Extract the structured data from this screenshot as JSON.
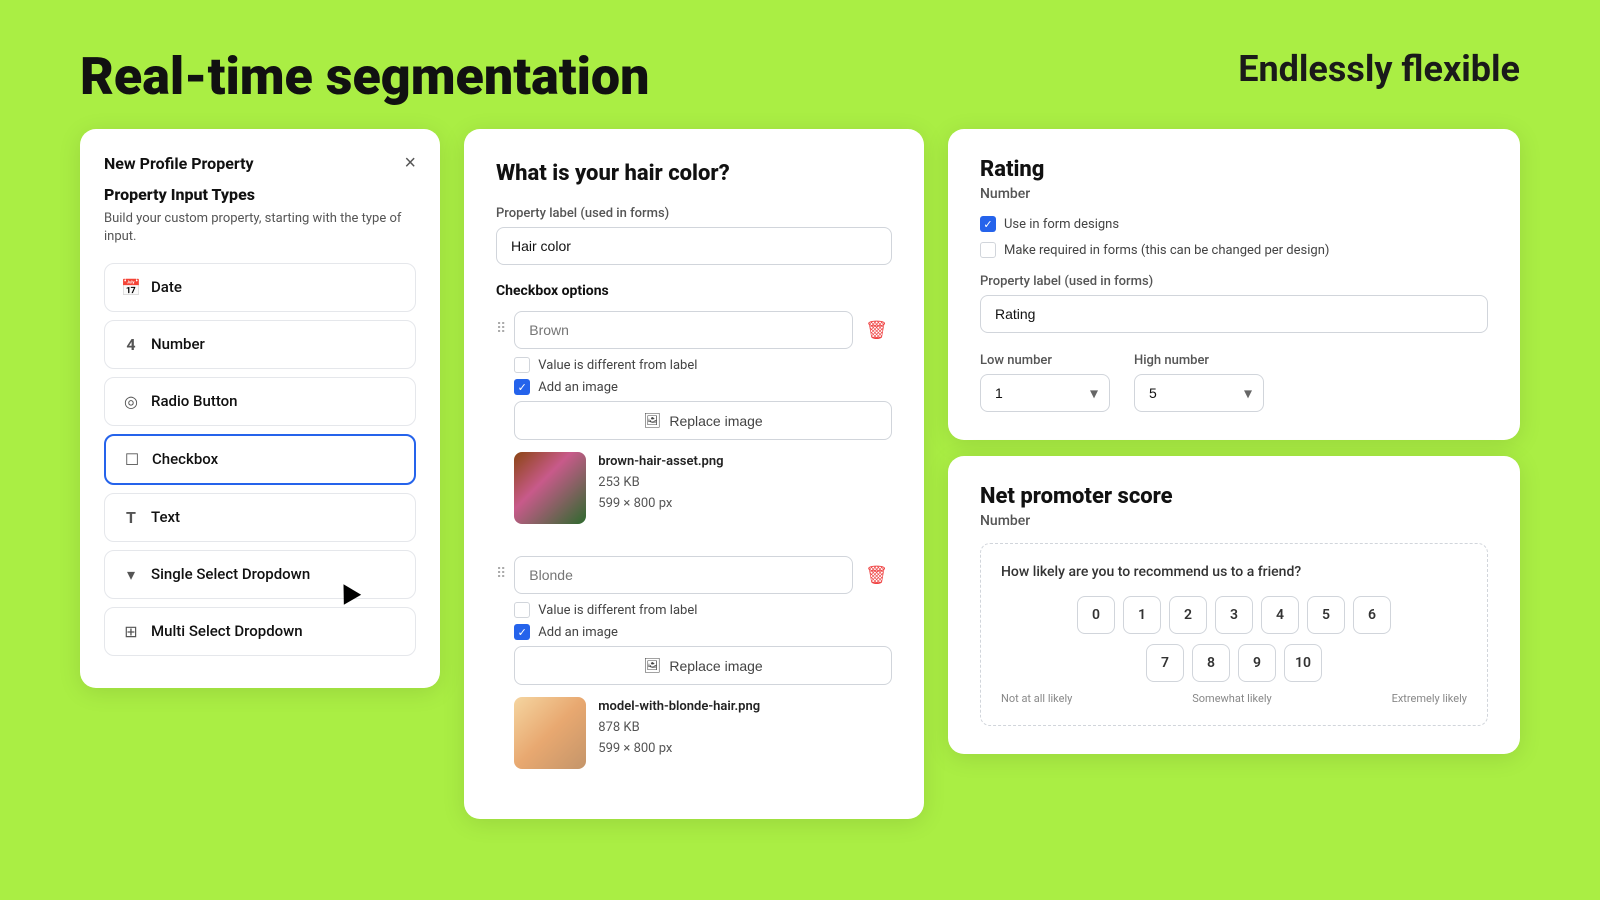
{
  "page": {
    "background_color": "#aaee44",
    "main_title": "Real-time segmentation",
    "sub_title": "Endlessly flexible"
  },
  "left_panel": {
    "title": "New Profile Property",
    "close_label": "×",
    "section_title": "Property Input Types",
    "section_desc": "Build your custom property, starting with the type of input.",
    "items": [
      {
        "id": "date",
        "icon": "📅",
        "label": "Date",
        "active": false
      },
      {
        "id": "number",
        "icon": "4",
        "label": "Number",
        "active": false
      },
      {
        "id": "radio",
        "icon": "◎",
        "label": "Radio Button",
        "active": false
      },
      {
        "id": "checkbox",
        "icon": "☐",
        "label": "Checkbox",
        "active": true
      },
      {
        "id": "text",
        "icon": "T",
        "label": "Text",
        "active": false
      },
      {
        "id": "single-select",
        "icon": "▼",
        "label": "Single Select Dropdown",
        "active": false
      },
      {
        "id": "multi-select",
        "icon": "⊞",
        "label": "Multi Select Dropdown",
        "active": false
      }
    ]
  },
  "middle_panel": {
    "title": "What is your hair color?",
    "property_label_label": "Property label (used in forms)",
    "property_label_value": "Hair color",
    "property_label_placeholder": "Hair color",
    "checkbox_options_label": "Checkbox options",
    "options": [
      {
        "id": "brown",
        "placeholder": "Brown",
        "value_different": false,
        "add_image": true,
        "replace_image_label": "Replace image",
        "image_name": "brown-hair-asset.png",
        "image_size": "253 KB",
        "image_dims": "599 × 800 px"
      },
      {
        "id": "blonde",
        "placeholder": "Blonde",
        "value_different": false,
        "add_image": true,
        "replace_image_label": "Replace image",
        "image_name": "model-with-blonde-hair.png",
        "image_size": "878 KB",
        "image_dims": "599 × 800 px"
      }
    ]
  },
  "rating_panel": {
    "title": "Rating",
    "subtitle": "Number",
    "checkbox1_label": "Use in form designs",
    "checkbox1_checked": true,
    "checkbox2_label": "Make required in forms (this can be changed per design)",
    "checkbox2_checked": false,
    "property_label_label": "Property label (used in forms)",
    "property_label_value": "Rating",
    "low_number_label": "Low number",
    "low_number_value": "1",
    "high_number_label": "High number",
    "high_number_value": "5"
  },
  "nps_panel": {
    "title": "Net promoter score",
    "subtitle": "Number",
    "question": "How likely are you to recommend us to a friend?",
    "numbers_row1": [
      "0",
      "1",
      "2",
      "3",
      "4",
      "5",
      "6"
    ],
    "numbers_row2": [
      "7",
      "8",
      "9",
      "10"
    ],
    "label_left": "Not at all likely",
    "label_middle": "Somewhat likely",
    "label_right": "Extremely likely"
  }
}
